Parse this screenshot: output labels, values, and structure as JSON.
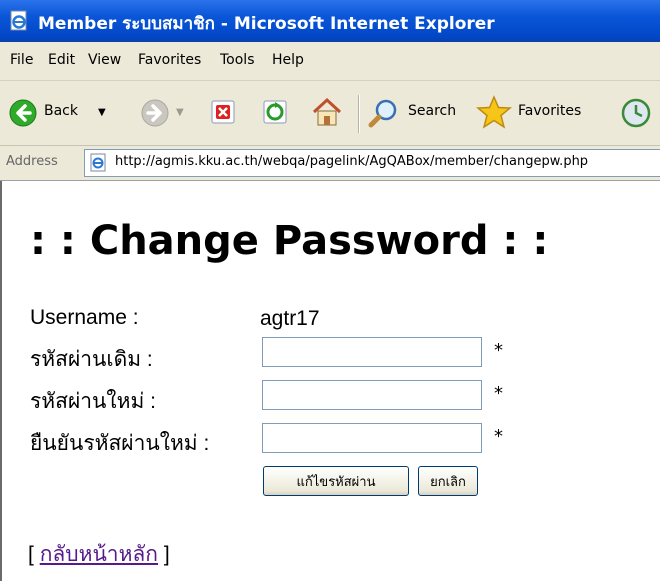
{
  "window": {
    "title": "Member ระบบสมาชิก - Microsoft Internet Explorer"
  },
  "menu": [
    "File",
    "Edit",
    "View",
    "Favorites",
    "Tools",
    "Help"
  ],
  "toolbar": {
    "back_label": "Back",
    "search_label": "Search",
    "favorites_label": "Favorites"
  },
  "address": {
    "label": "Address",
    "url": "http://agmis.kku.ac.th/webqa/pagelink/AgQABox/member/changepw.php"
  },
  "page": {
    "heading": ": : Change Password : :",
    "username_label": "Username :",
    "username_value": "agtr17",
    "old_password_label": "รหัสผ่านเดิม :",
    "new_password_label": "รหัสผ่านใหม่ :",
    "confirm_password_label": "ยืนยันรหัสผ่านใหม่ :",
    "required_mark": "*",
    "submit_label": "แก้ไขรหัสผ่าน",
    "cancel_label": "ยกเลิก",
    "bracket_open": "[",
    "bracket_close": "]",
    "back_link": "กลับหน้าหลัก"
  },
  "colors": {
    "titlebar": "#0a55d8",
    "chrome": "#ece9d8",
    "link_visited": "#551a8b"
  }
}
